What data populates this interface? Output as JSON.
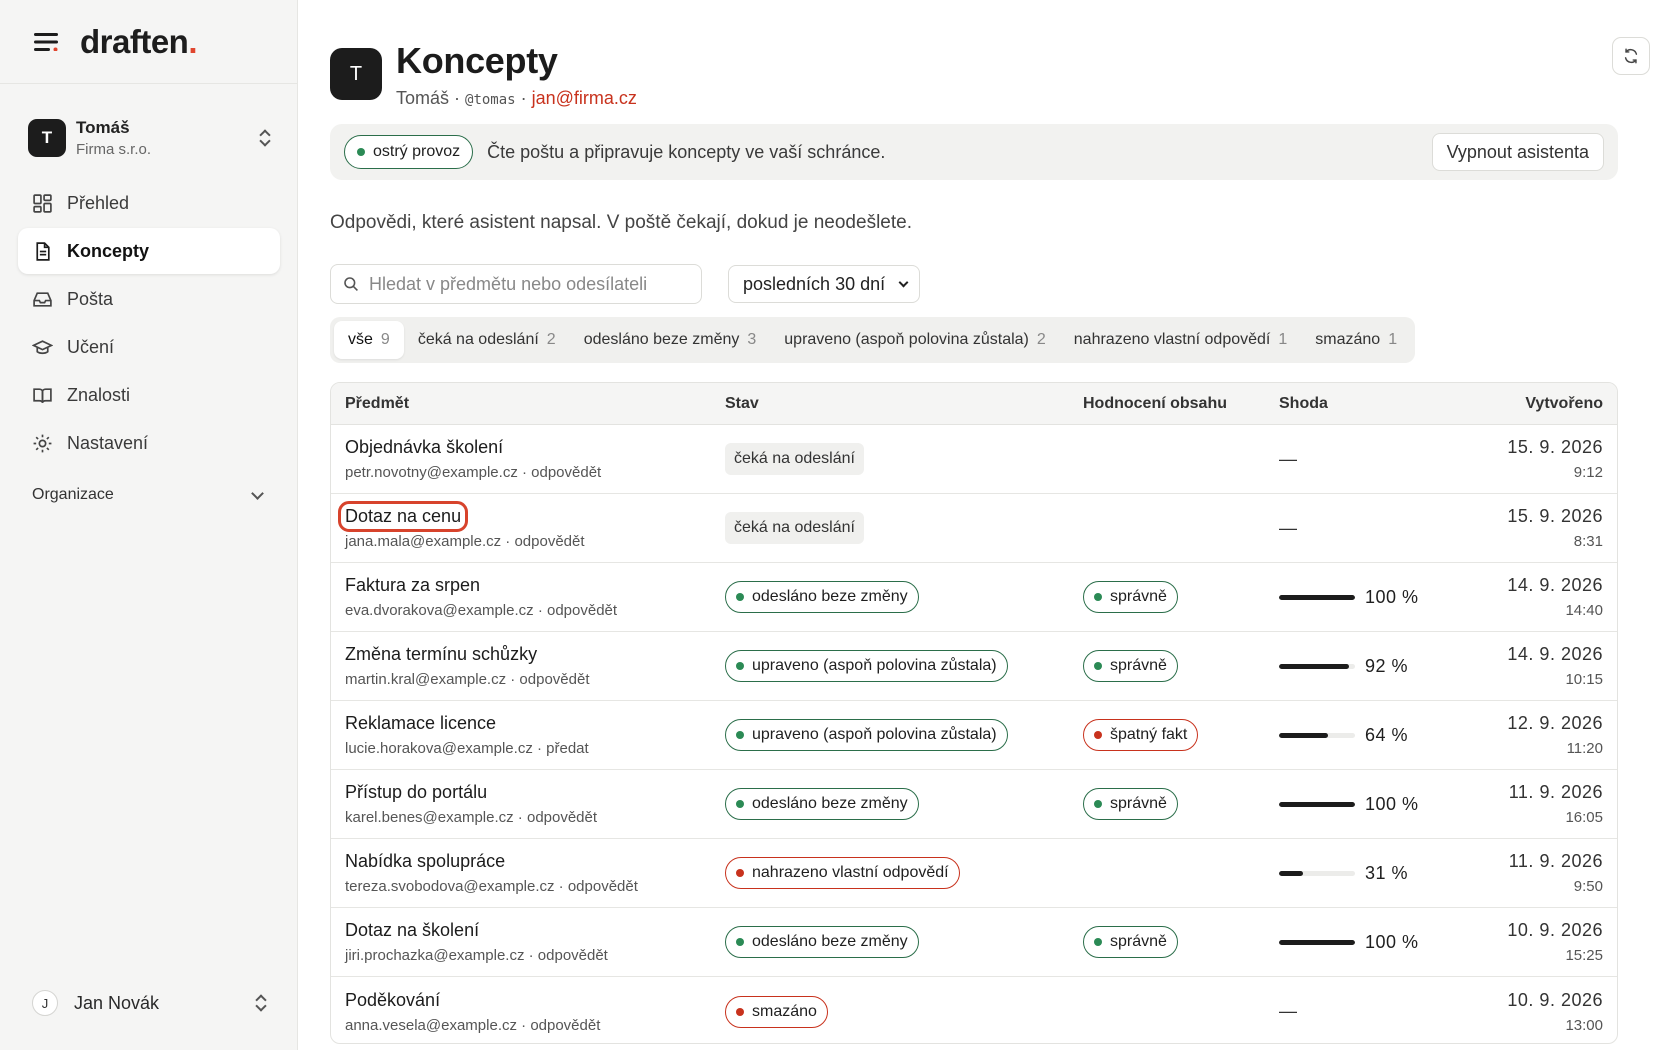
{
  "brand": {
    "name": "draften",
    "dot": ".",
    "accent": "#e0452e"
  },
  "workspace": {
    "initial": "T",
    "name": "Tomáš",
    "org": "Firma s.r.o."
  },
  "nav": [
    {
      "label": "Přehled",
      "icon": "grid-icon",
      "active": false
    },
    {
      "label": "Koncepty",
      "icon": "document-icon",
      "active": true
    },
    {
      "label": "Pošta",
      "icon": "inbox-icon",
      "active": false
    },
    {
      "label": "Učení",
      "icon": "graduation-cap-icon",
      "active": false
    },
    {
      "label": "Znalosti",
      "icon": "book-icon",
      "active": false
    },
    {
      "label": "Nastavení",
      "icon": "gear-icon",
      "active": false
    }
  ],
  "organization_label": "Organizace",
  "user": {
    "initial": "J",
    "name": "Jan Novák"
  },
  "header": {
    "initial": "T",
    "title": "Koncepty",
    "name": "Tomáš",
    "sep1": " · ",
    "handle": "@tomas",
    "sep2": " · ",
    "email": "jan@firma.cz"
  },
  "banner": {
    "status": "ostrý provoz",
    "text": "Čte poštu a připravuje koncepty ve vaší schránce.",
    "button": "Vypnout asistenta"
  },
  "description": "Odpovědi, které asistent napsal. V poště čekají, dokud je neodešlete.",
  "search": {
    "placeholder": "Hledat v předmětu nebo odesílateli",
    "value": ""
  },
  "period": {
    "selected": "posledních 30 dní"
  },
  "tabs": [
    {
      "label": "vše",
      "count": "9",
      "active": true
    },
    {
      "label": "čeká na odeslání",
      "count": "2",
      "active": false
    },
    {
      "label": "odesláno beze změny",
      "count": "3",
      "active": false
    },
    {
      "label": "upraveno (aspoň polovina zůstala)",
      "count": "2",
      "active": false
    },
    {
      "label": "nahrazeno vlastní odpovědí",
      "count": "1",
      "active": false
    },
    {
      "label": "smazáno",
      "count": "1",
      "active": false
    }
  ],
  "table": {
    "columns": [
      "Předmět",
      "Stav",
      "Hodnocení obsahu",
      "Shoda",
      "Vytvořeno"
    ],
    "rows": [
      {
        "subject": "Objednávka školení",
        "meta": "petr.novotny@example.cz · odpovědět",
        "status": "čeká na odeslání",
        "status_style": "gray",
        "rating": "",
        "rating_style": "",
        "match": "—",
        "match_fraction": null,
        "date": "15. 9. 2026",
        "time": "9:12",
        "highlight": false
      },
      {
        "subject": "Dotaz na cenu",
        "meta": "jana.mala@example.cz · odpovědět",
        "status": "čeká na odeslání",
        "status_style": "gray",
        "rating": "",
        "rating_style": "",
        "match": "—",
        "match_fraction": null,
        "date": "15. 9. 2026",
        "time": "8:31",
        "highlight": true
      },
      {
        "subject": "Faktura za srpen",
        "meta": "eva.dvorakova@example.cz · odpovědět",
        "status": "odesláno beze změny",
        "status_style": "green",
        "rating": "správně",
        "rating_style": "green",
        "match": "100 %",
        "match_fraction": 1.0,
        "date": "14. 9. 2026",
        "time": "14:40",
        "highlight": false
      },
      {
        "subject": "Změna termínu schůzky",
        "meta": "martin.kral@example.cz · odpovědět",
        "status": "upraveno (aspoň polovina zůstala)",
        "status_style": "green",
        "rating": "správně",
        "rating_style": "green",
        "match": "92 %",
        "match_fraction": 0.92,
        "date": "14. 9. 2026",
        "time": "10:15",
        "highlight": false
      },
      {
        "subject": "Reklamace licence",
        "meta": "lucie.horakova@example.cz · předat",
        "status": "upraveno (aspoň polovina zůstala)",
        "status_style": "green",
        "rating": "špatný fakt",
        "rating_style": "red",
        "match": "64 %",
        "match_fraction": 0.64,
        "date": "12. 9. 2026",
        "time": "11:20",
        "highlight": false
      },
      {
        "subject": "Přístup do portálu",
        "meta": "karel.benes@example.cz · odpovědět",
        "status": "odesláno beze změny",
        "status_style": "green",
        "rating": "správně",
        "rating_style": "green",
        "match": "100 %",
        "match_fraction": 1.0,
        "date": "11. 9. 2026",
        "time": "16:05",
        "highlight": false
      },
      {
        "subject": "Nabídka spolupráce",
        "meta": "tereza.svobodova@example.cz · odpovědět",
        "status": "nahrazeno vlastní odpovědí",
        "status_style": "red",
        "rating": "",
        "rating_style": "",
        "match": "31 %",
        "match_fraction": 0.31,
        "date": "11. 9. 2026",
        "time": "9:50",
        "highlight": false
      },
      {
        "subject": "Dotaz na školení",
        "meta": "jiri.prochazka@example.cz · odpovědět",
        "status": "odesláno beze změny",
        "status_style": "green",
        "rating": "správně",
        "rating_style": "green",
        "match": "100 %",
        "match_fraction": 1.0,
        "date": "10. 9. 2026",
        "time": "15:25",
        "highlight": false
      },
      {
        "subject": "Poděkování",
        "meta": "anna.vesela@example.cz · odpovědět",
        "status": "smazáno",
        "status_style": "red",
        "rating": "",
        "rating_style": "",
        "match": "—",
        "match_fraction": null,
        "date": "10. 9. 2026",
        "time": "13:00",
        "highlight": false
      }
    ]
  },
  "colors": {
    "green": "#2b6e4a",
    "red": "#c8321d",
    "dark": "#1c1c1c"
  }
}
